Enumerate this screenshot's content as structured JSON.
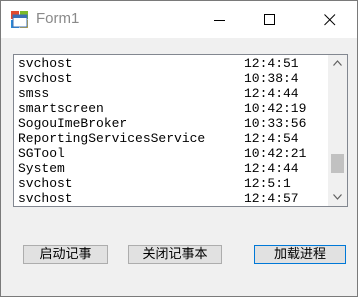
{
  "window": {
    "title": "Form1"
  },
  "process_list": {
    "rows": [
      {
        "name": "svchost",
        "time": "12:4:51"
      },
      {
        "name": "svchost",
        "time": "10:38:4"
      },
      {
        "name": "smss",
        "time": "12:4:44"
      },
      {
        "name": "smartscreen",
        "time": "10:42:19"
      },
      {
        "name": "SogouImeBroker",
        "time": "10:33:56"
      },
      {
        "name": "ReportingServicesService",
        "time": "12:4:54"
      },
      {
        "name": "SGTool",
        "time": "10:42:21"
      },
      {
        "name": "System",
        "time": "12:4:44"
      },
      {
        "name": "svchost",
        "time": "12:5:1"
      },
      {
        "name": "svchost",
        "time": "12:4:57"
      }
    ],
    "scroll_position": 0.84,
    "scroll_visible_fraction": 0.16
  },
  "buttons": {
    "start_notepad": "启动记事",
    "close_notepad": "关闭记事本",
    "load_process": "加载进程"
  },
  "colors": {
    "default_button_border": "#0078d7",
    "title_text": "#8a8a8a"
  }
}
